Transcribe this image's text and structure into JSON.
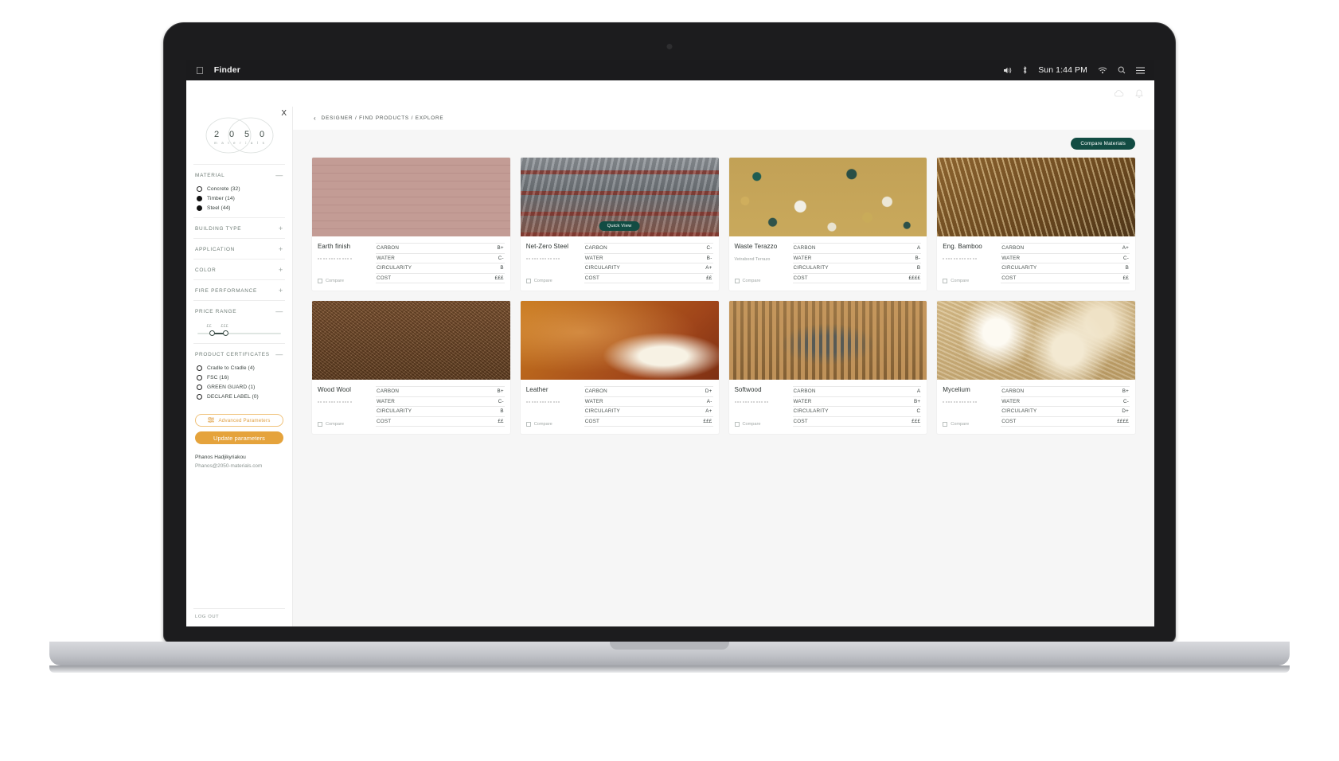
{
  "menubar": {
    "apple": "apple-logo",
    "app_name": "Finder",
    "clock": "Sun 1:44 PM",
    "icons": [
      "volume-icon",
      "bluetooth-icon",
      "wifi-icon",
      "search-icon",
      "control-center-icon"
    ]
  },
  "app_topbar": {
    "icons": [
      "cloud-icon",
      "bell-icon"
    ]
  },
  "sidebar": {
    "close_label": "X",
    "logo": {
      "digits": [
        "2",
        "0",
        "5",
        "0"
      ],
      "wordmark": "m a t e r i a l s"
    },
    "sections": [
      {
        "title": "MATERIAL",
        "toggle": "—",
        "options": [
          {
            "label": "Concrete (32)",
            "selected": false
          },
          {
            "label": "Timber (14)",
            "selected": true
          },
          {
            "label": "Steel (44)",
            "selected": true
          }
        ]
      },
      {
        "title": "BUILDING TYPE",
        "toggle": "+"
      },
      {
        "title": "APPLICATION",
        "toggle": "+"
      },
      {
        "title": "COLOR",
        "toggle": "+"
      },
      {
        "title": "FIRE PERFORMANCE",
        "toggle": "+"
      },
      {
        "title": "PRICE RANGE",
        "toggle": "—",
        "slider": {
          "min_label": "££",
          "max_label": "£££"
        }
      },
      {
        "title": "PRODUCT CERTIFICATES",
        "toggle": "—",
        "options": [
          {
            "label": "Cradle to Cradle (4)",
            "selected": false
          },
          {
            "label": "FSC (16)",
            "selected": false
          },
          {
            "label": "GREEN GUARD (1)",
            "selected": false
          },
          {
            "label": "DECLARE LABEL (0)",
            "selected": false
          }
        ]
      }
    ],
    "advanced_button": "Advanced Parameters",
    "update_button": "Update parameters",
    "user_name": "Phanos Hadjikyriakou",
    "user_email": "Phanos@2050-materials.com",
    "logout": "LOG OUT"
  },
  "main": {
    "breadcrumb": "DESIGNER / FIND PRODUCTS / EXPLORE",
    "back_icon": "chevron-left-icon",
    "compare_button": "Compare Materials",
    "quick_view_label": "Quick View",
    "compare_checkbox_label": "Compare",
    "metric_keys": [
      "CARBON",
      "WATER",
      "CIRCULARITY",
      "COST"
    ],
    "cards": [
      {
        "title": "Earth finish",
        "subtitle": "",
        "image": "rammed-earth-wall",
        "quick_view": false,
        "metrics": {
          "CARBON": "B+",
          "WATER": "C-",
          "CIRCULARITY": "B",
          "COST": "£££"
        }
      },
      {
        "title": "Net-Zero Steel",
        "subtitle": "",
        "image": "steel-frame-structure",
        "quick_view": true,
        "metrics": {
          "CARBON": "C-",
          "WATER": "B-",
          "CIRCULARITY": "A+",
          "COST": "££"
        }
      },
      {
        "title": "Waste Terazzo",
        "subtitle": "Vetrabond Terrazo",
        "image": "terrazzo-surface",
        "quick_view": false,
        "metrics": {
          "CARBON": "A",
          "WATER": "B-",
          "CIRCULARITY": "B",
          "COST": "££££"
        }
      },
      {
        "title": "Eng. Bamboo",
        "subtitle": "",
        "image": "bamboo-structure",
        "quick_view": false,
        "metrics": {
          "CARBON": "A+",
          "WATER": "C-",
          "CIRCULARITY": "B",
          "COST": "££"
        }
      },
      {
        "title": "Wood Wool",
        "subtitle": "",
        "image": "wood-wool-texture",
        "quick_view": false,
        "metrics": {
          "CARBON": "B+",
          "WATER": "C-",
          "CIRCULARITY": "B",
          "COST": "££"
        }
      },
      {
        "title": "Leather",
        "subtitle": "",
        "image": "leather-texture",
        "quick_view": false,
        "metrics": {
          "CARBON": "D+",
          "WATER": "A-",
          "CIRCULARITY": "A+",
          "COST": "£££"
        }
      },
      {
        "title": "Softwood",
        "subtitle": "",
        "image": "softwood-interior",
        "quick_view": false,
        "metrics": {
          "CARBON": "A",
          "WATER": "B+",
          "CIRCULARITY": "C",
          "COST": "£££"
        }
      },
      {
        "title": "Mycelium",
        "subtitle": "",
        "image": "mycelium-growth",
        "quick_view": false,
        "metrics": {
          "CARBON": "B+",
          "WATER": "C-",
          "CIRCULARITY": "D+",
          "COST": "££££"
        }
      }
    ]
  },
  "colors": {
    "brand_green": "#124c43",
    "accent_orange": "#e5a33c",
    "sidebar_text": "#6e7b75"
  }
}
